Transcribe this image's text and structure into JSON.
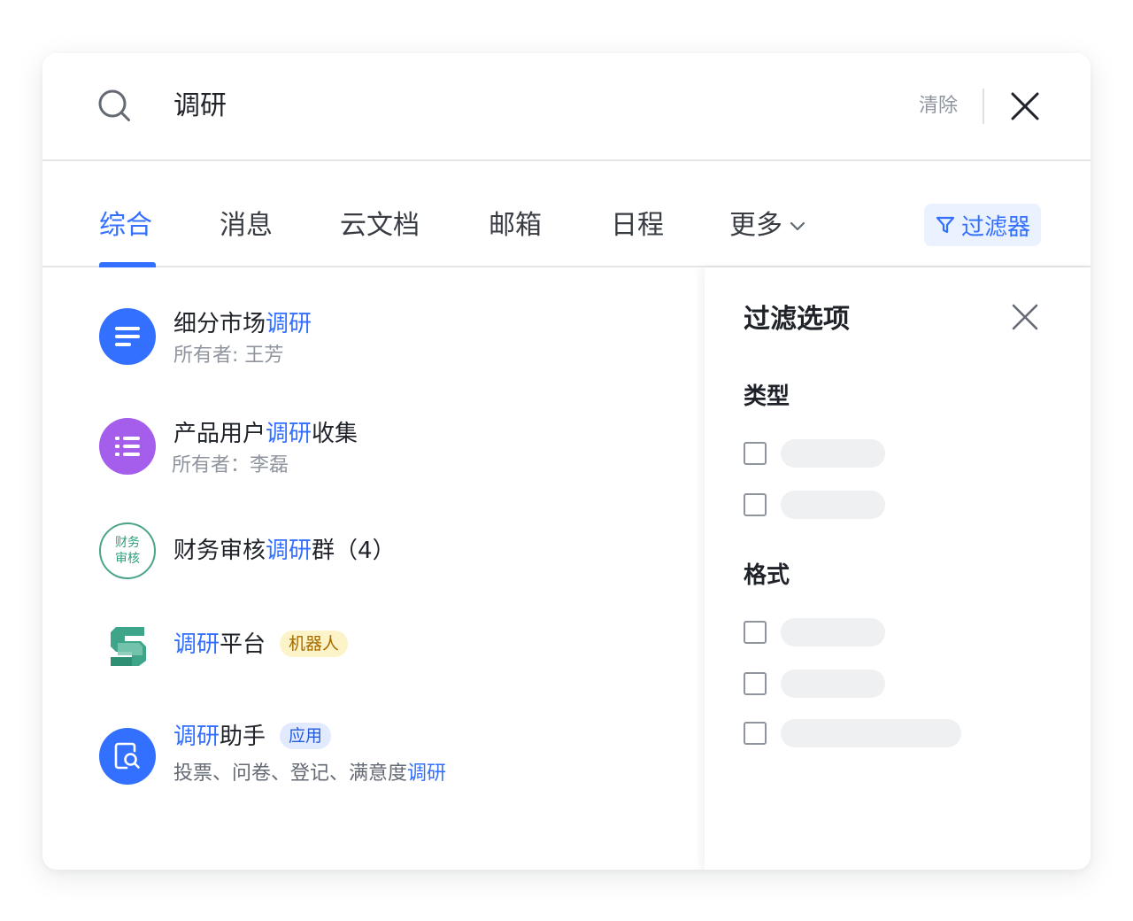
{
  "search": {
    "query": "调研",
    "clear_label": "清除"
  },
  "tabs": [
    {
      "label": "综合",
      "active": true
    },
    {
      "label": "消息"
    },
    {
      "label": "云文档"
    },
    {
      "label": "邮箱"
    },
    {
      "label": "日程"
    },
    {
      "label": "更多"
    }
  ],
  "filter_button": {
    "label": "过滤器"
  },
  "results": [
    {
      "title_before": "细分市场",
      "title_hl": "调研",
      "title_after": "",
      "subtitle": "所有者: 王芳",
      "icon": "doc-lines-icon",
      "avatar_color": "#3370ff"
    },
    {
      "title_before": "产品用户",
      "title_hl": "调研",
      "title_after": "收集",
      "subtitle": "所有者：李磊",
      "icon": "list-icon",
      "avatar_color": "#a45eeb"
    },
    {
      "title_before": "财务审核",
      "title_hl": "调研",
      "title_after": "群（4）",
      "avatar_line1": "财务",
      "avatar_line2": "审核",
      "icon": "group-chat-avatar"
    },
    {
      "title_before": "",
      "title_hl": "调研",
      "title_after": "平台",
      "tag": "机器人",
      "icon": "bot-s-logo-icon"
    },
    {
      "title_before": "",
      "title_hl": "调研",
      "title_after": "助手",
      "tag": "应用",
      "subtitle_before": "投票、问卷、登记、满意度",
      "subtitle_hl": "调研",
      "icon": "app-search-icon",
      "avatar_color": "#3370ff"
    }
  ],
  "filter_panel": {
    "title": "过滤选项",
    "sections": [
      {
        "label": "类型",
        "options": 2
      },
      {
        "label": "格式",
        "options": 3
      }
    ]
  },
  "colors": {
    "accent": "#3370ff",
    "text": "#1f2329",
    "muted": "#8f959e"
  }
}
